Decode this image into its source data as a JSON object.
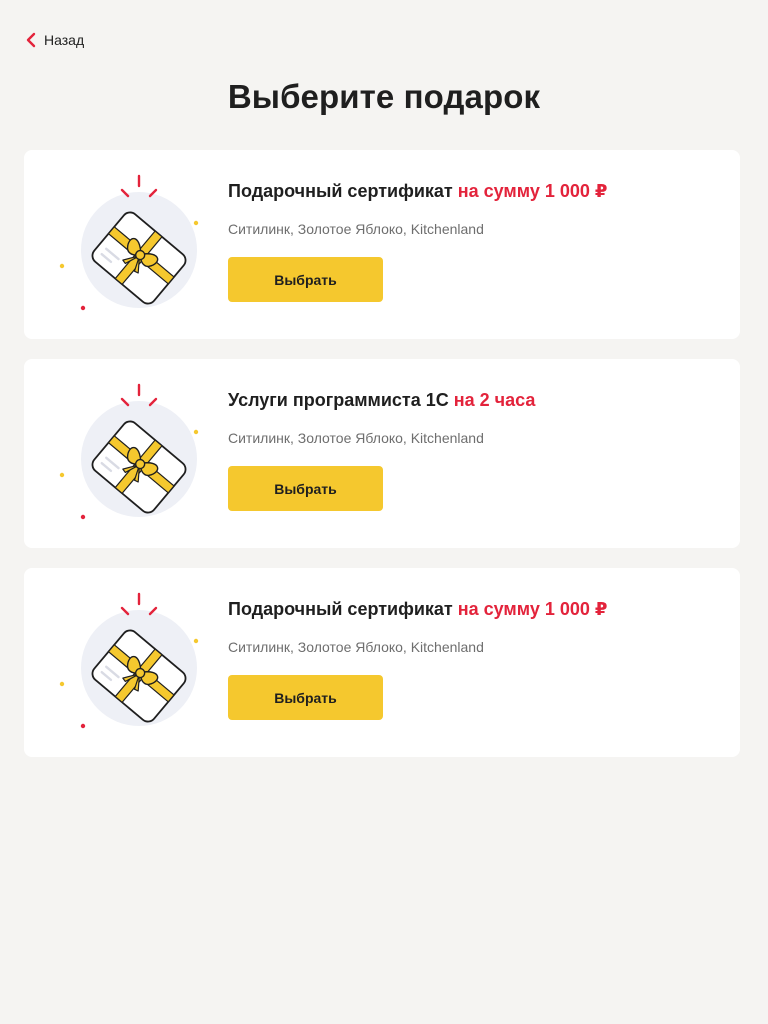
{
  "nav": {
    "back_label": "Назад",
    "back_icon": "chevron-left-icon"
  },
  "page": {
    "title": "Выберите подарок"
  },
  "colors": {
    "accent_red": "#e3233b",
    "button_yellow": "#f5c82e",
    "background": "#f5f4f2",
    "card": "#ffffff"
  },
  "gifts": [
    {
      "title_main": "Подарочный сертификат",
      "title_accent": "на сумму 1 000 ₽",
      "stores": "Ситилинк, Золотое Яблоко, Kitchenland",
      "button_label": "Выбрать",
      "icon": "gift-card-icon"
    },
    {
      "title_main": "Услуги программиста 1С",
      "title_accent": "на 2 часа",
      "stores": "Ситилинк, Золотое Яблоко, Kitchenland",
      "button_label": "Выбрать",
      "icon": "gift-card-icon"
    },
    {
      "title_main": "Подарочный сертификат",
      "title_accent": "на сумму 1 000 ₽",
      "stores": "Ситилинк, Золотое Яблоко, Kitchenland",
      "button_label": "Выбрать",
      "icon": "gift-card-icon"
    }
  ]
}
